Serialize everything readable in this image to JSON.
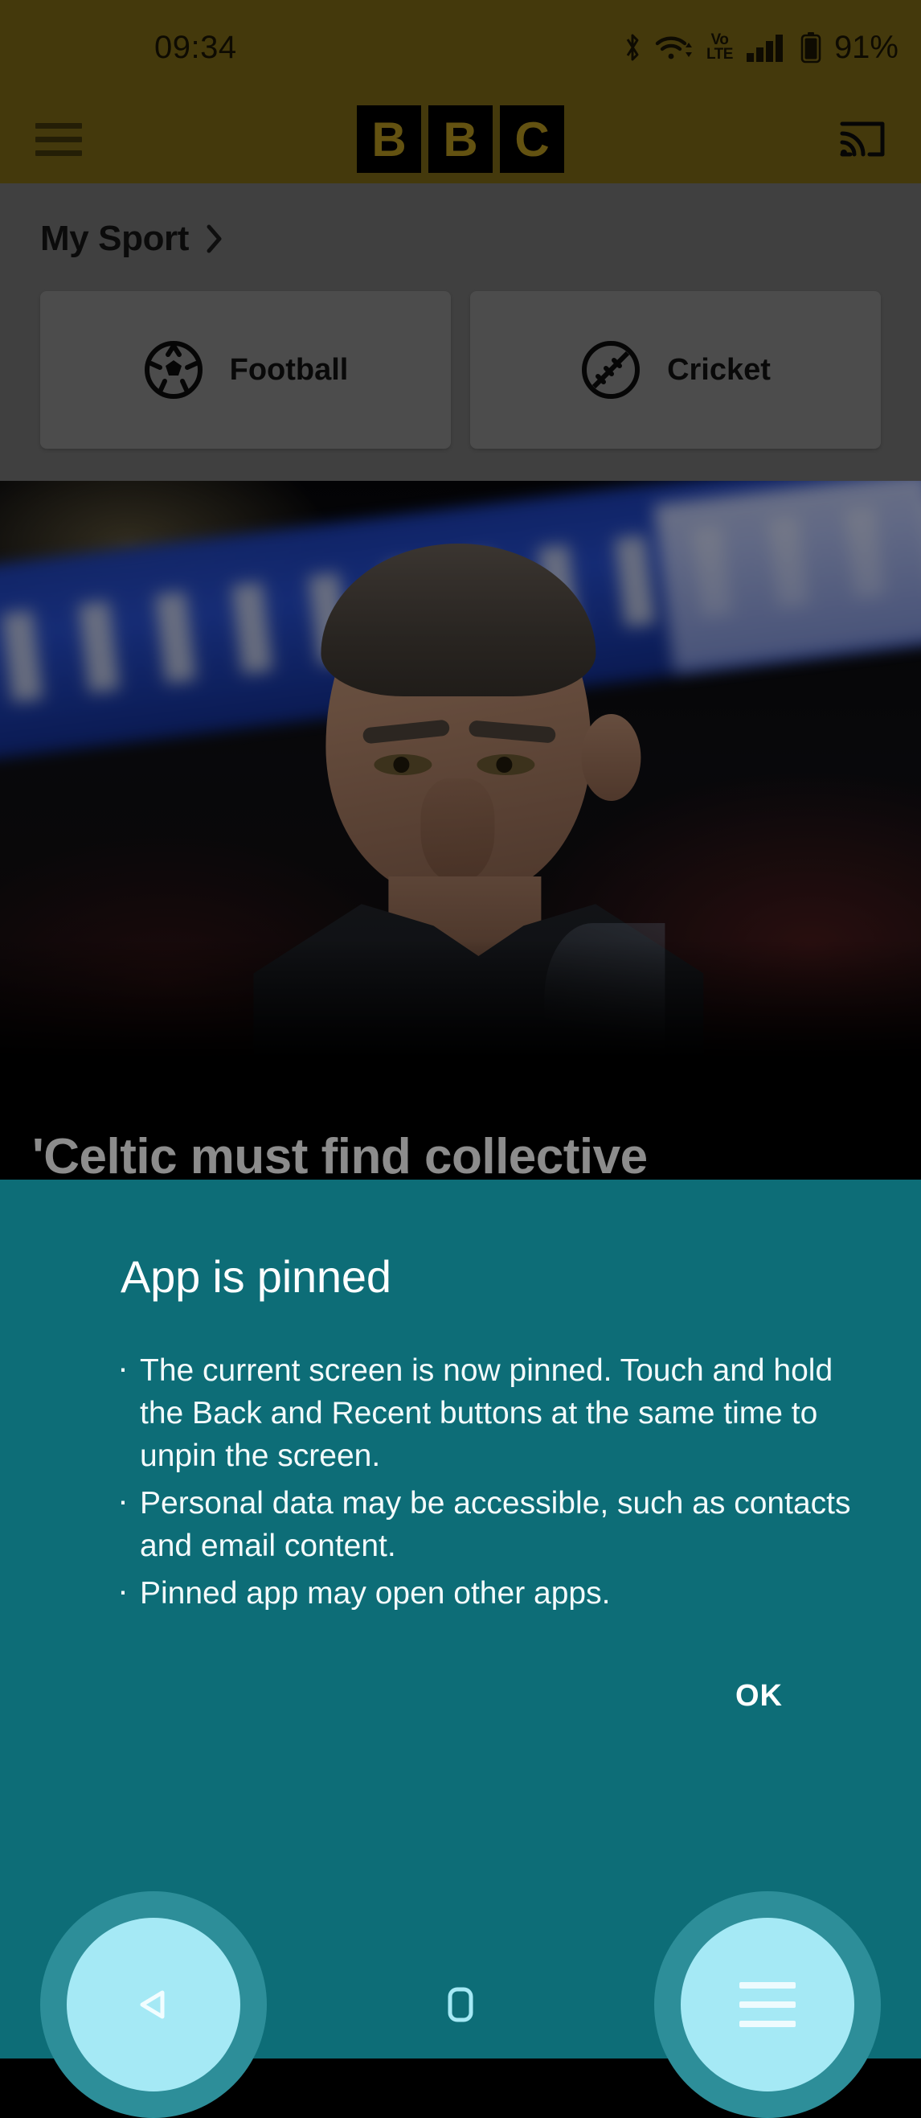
{
  "statusbar": {
    "time": "09:34",
    "battery_percent": "91%",
    "volte_top": "Vo",
    "volte_bottom": "LTE",
    "icons": [
      "bluetooth-icon",
      "wifi-icon",
      "volte-icon",
      "signal-icon",
      "battery-icon"
    ]
  },
  "appbar": {
    "menu_label": "menu",
    "logo_letters": [
      "B",
      "B",
      "C"
    ],
    "cast_label": "cast"
  },
  "mysport": {
    "title": "My Sport",
    "cards": [
      {
        "label": "Football",
        "icon": "football-icon"
      },
      {
        "label": "Cricket",
        "icon": "cricket-ball-icon"
      }
    ]
  },
  "article": {
    "headline": "'Celtic must find collective"
  },
  "pin_dialog": {
    "title": "App is pinned",
    "bullets": [
      "The current screen is now pinned. Touch and hold the Back and Recent buttons at the same time to unpin the screen.",
      "Personal data may be accessible, such as contacts and email content.",
      "Pinned app may open other apps."
    ],
    "ok_label": "OK"
  },
  "navbar": {
    "back_label": "Back",
    "home_label": "Home",
    "recents_label": "Recent apps"
  },
  "colors": {
    "brand_gold": "#7d6916",
    "mysport_gray": "#757575",
    "card_gray": "#8b8b8b",
    "dialog_teal": "#0d6d77",
    "ripple_outer": "#2d8e99",
    "ripple_inner": "#a5e9f5"
  }
}
